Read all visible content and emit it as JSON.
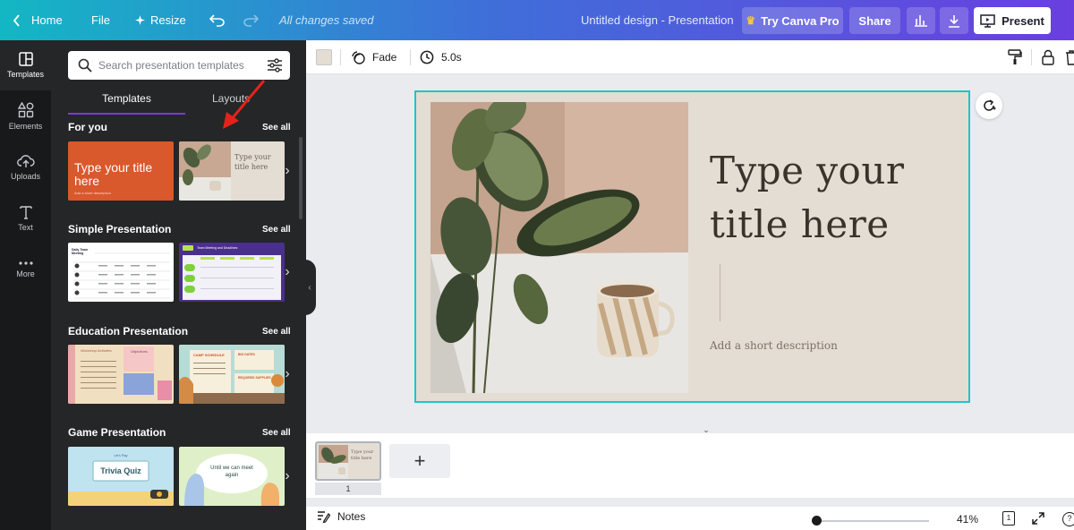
{
  "topbar": {
    "home_label": "Home",
    "file_label": "File",
    "resize_label": "Resize",
    "saved_status": "All changes saved",
    "doc_title": "Untitled design - Presentation",
    "try_pro_label": "Try Canva Pro",
    "share_label": "Share",
    "present_label": "Present"
  },
  "rail": {
    "items": [
      {
        "label": "Templates",
        "icon": "templates-icon",
        "active": true
      },
      {
        "label": "Elements",
        "icon": "elements-icon"
      },
      {
        "label": "Uploads",
        "icon": "cloud-upload-icon"
      },
      {
        "label": "Text",
        "icon": "text-icon"
      },
      {
        "label": "More",
        "icon": "more-dots-icon"
      }
    ]
  },
  "panel": {
    "search_placeholder": "Search presentation templates",
    "tabs": {
      "templates": "Templates",
      "layouts": "Layouts"
    },
    "see_all": "See all",
    "sections": [
      {
        "title": "For you"
      },
      {
        "title": "Simple Presentation"
      },
      {
        "title": "Education Presentation"
      },
      {
        "title": "Game Presentation"
      }
    ],
    "thumbs": {
      "for_you_1_title": "Type your title here",
      "for_you_1_sub": "Add a short description",
      "for_you_2_title": "Type your title here",
      "simple_1_title": "Daily Team Meeting",
      "simple_2_title": "Team Meeting and Deadlines",
      "edu_1_title": "Workshop Activities",
      "edu_1_right": "Objectives",
      "edu_2_title": "CAMP SCHEDULE",
      "edu_2_right": "BIG DATES",
      "edu_2_right2": "REQUIRED SUPPLIES",
      "game_1_small": "Let's Play",
      "game_1_title": "Trivia Quiz",
      "game_2_title": "Until we can meet again"
    }
  },
  "toolbar": {
    "transition_label": "Fade",
    "duration_label": "5.0s",
    "bg_color": "#e4ddd3"
  },
  "slide": {
    "title": "Type your title here",
    "description": "Add a short description"
  },
  "pages": {
    "current_page": "1",
    "thumb_title": "Type your title here",
    "add_label": "+"
  },
  "bottombar": {
    "notes_label": "Notes",
    "zoom_level": "41%",
    "pages_count": "1",
    "help_label": "?"
  },
  "colors": {
    "accent": "#8b3dff",
    "selection": "#20c4cb",
    "annotation_arrow": "#e3231b"
  }
}
